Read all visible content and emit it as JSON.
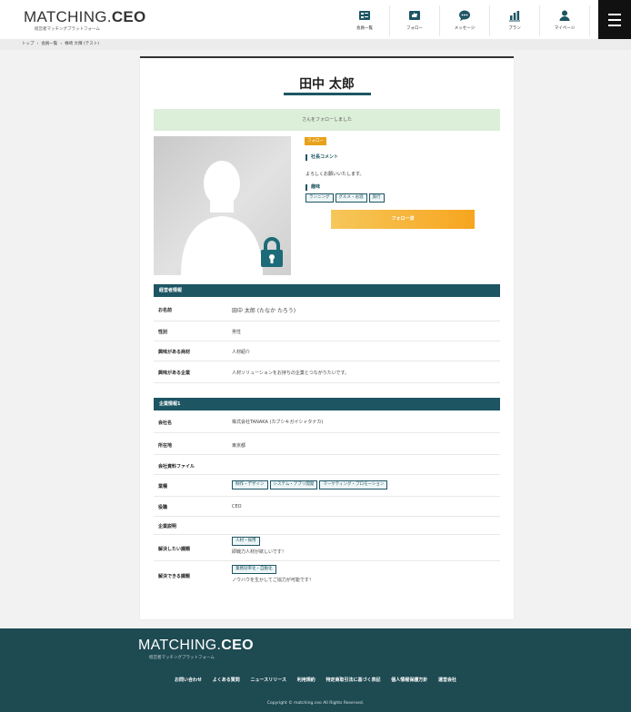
{
  "header": {
    "logo_light": "MATCHING.",
    "logo_bold": "CEO",
    "logo_sub": "経営者マッチングプラットフォーム",
    "nav": [
      {
        "label": "会員一覧",
        "icon": "member-list-icon"
      },
      {
        "label": "フォロー",
        "icon": "follow-icon"
      },
      {
        "label": "メッセージ",
        "icon": "message-icon"
      },
      {
        "label": "プラン",
        "icon": "plan-icon"
      },
      {
        "label": "マイページ",
        "icon": "mypage-icon"
      }
    ]
  },
  "breadcrumb": [
    "トップ",
    "会員一覧",
    "株崎 大輝 (テスト)"
  ],
  "profile": {
    "name": "田中 太郎",
    "follow_message": "さんをフォローしました",
    "follow_badge": "フォロー",
    "comment_label": "社長コメント",
    "comment": "よろしくお願いいたします。",
    "hobby_label": "趣味",
    "hobbies": [
      "ランニング",
      "グルメ・お酒",
      "旅行"
    ],
    "follow_button": "フォロー済"
  },
  "manager_info": {
    "title": "経営者情報",
    "rows": [
      {
        "label": "お名前",
        "value": "田中 太郎 (たなか たろう)"
      },
      {
        "label": "性別",
        "value": "男性"
      },
      {
        "label": "興味がある商材",
        "value": "人材紹介"
      },
      {
        "label": "興味がある企業",
        "value": "人材ソリューションをお持ちの企業とつながりたいです。"
      }
    ]
  },
  "company_info": {
    "title": "企業情報1",
    "company_name_label": "会社名",
    "company_name": "株式会社TANAKA (カブシキガイシャタナカ)",
    "location_label": "所在地",
    "location": "東京都",
    "files_label": "会社資料ファイル",
    "industry_label": "業種",
    "industries": [
      "制作・デザイン",
      "システム・アプリ開発",
      "マーケティング・プロモーション"
    ],
    "position_label": "役職",
    "position": "CEO",
    "description_label": "企業説明",
    "issue_label": "解決したい課題",
    "issue_tag": "人材・採用",
    "issue_text": "即戦力人材が欲しいです！",
    "solve_label": "解決できる課題",
    "solve_tag": "業務効率化・自動化",
    "solve_text": "ノウハウを生かしてご協力が可能です！"
  },
  "footer": {
    "logo_light": "MATCHING.",
    "logo_bold": "CEO",
    "logo_sub": "経営者マッチングプラットフォーム",
    "links": [
      "お問い合わせ",
      "よくある質問",
      "ニュースリリース",
      "利用規約",
      "特定商取引法に基づく表記",
      "個人情報保護方針",
      "運営会社"
    ],
    "copyright": "Copyright © matching.ceo All Rights Reserved."
  },
  "colors": {
    "primary": "#1d5563",
    "accent": "#f7a51f",
    "success_bg": "#dcefd9",
    "footer_bg": "#1e4a52"
  }
}
